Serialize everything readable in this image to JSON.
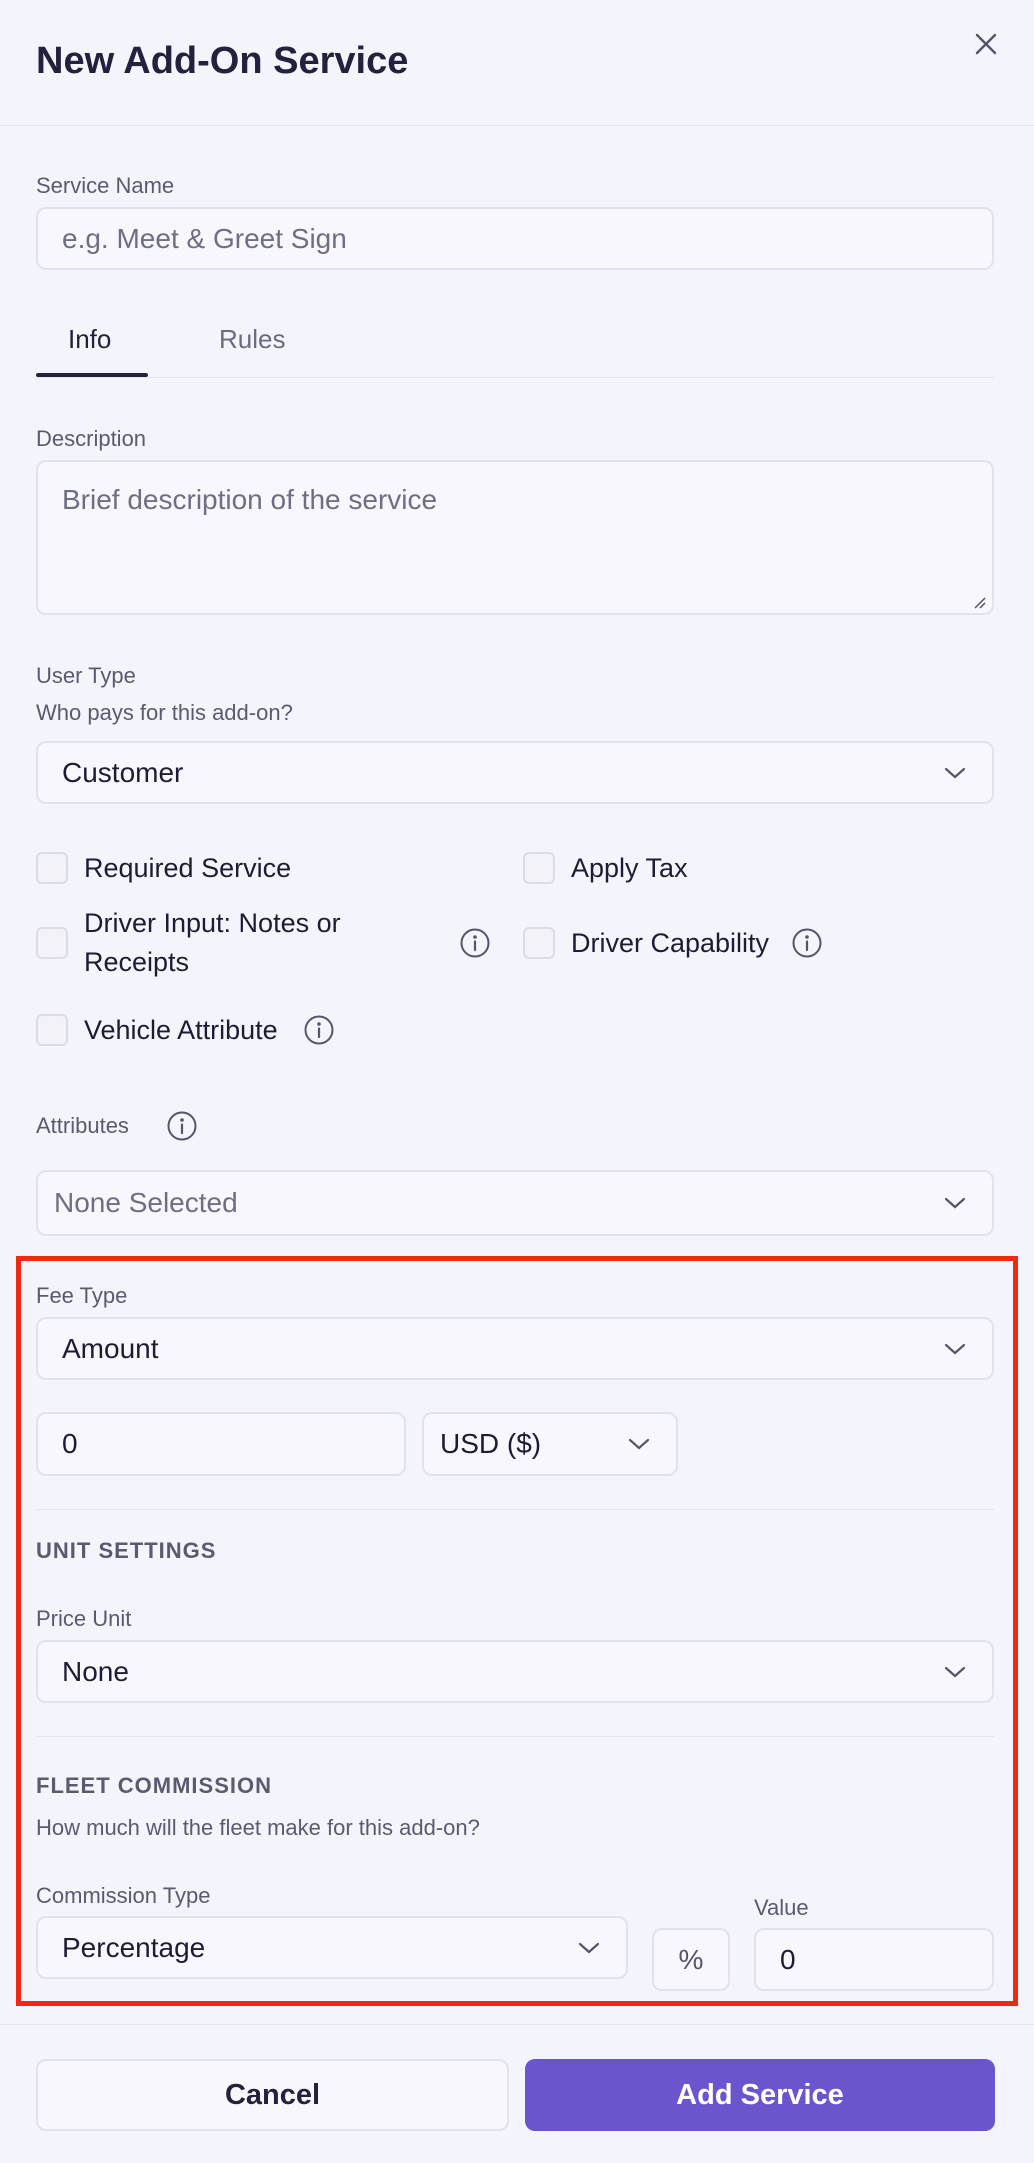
{
  "header": {
    "title": "New Add-On Service",
    "close_icon": "close-icon"
  },
  "service_name": {
    "label": "Service Name",
    "placeholder": "e.g. Meet & Greet Sign",
    "value": ""
  },
  "tabs": [
    {
      "label": "Info",
      "active": true
    },
    {
      "label": "Rules",
      "active": false
    }
  ],
  "description": {
    "label": "Description",
    "placeholder": "Brief description of the service",
    "value": ""
  },
  "user_type": {
    "label": "User Type",
    "hint": "Who pays for this add-on?",
    "selected": "Customer"
  },
  "checkboxes": [
    {
      "label": "Required Service",
      "checked": false,
      "info": false
    },
    {
      "label": "Apply Tax",
      "checked": false,
      "info": false
    },
    {
      "label_line1": "Driver Input: Notes or",
      "label_line2": "Receipts",
      "checked": false,
      "info": true
    },
    {
      "label": "Driver Capability",
      "checked": false,
      "info": true
    },
    {
      "label": "Vehicle Attribute",
      "checked": false,
      "info": true
    }
  ],
  "attributes": {
    "label": "Attributes",
    "selected": "None Selected"
  },
  "fee": {
    "label": "Fee Type",
    "selected": "Amount",
    "amount": "0",
    "currency": "USD ($)"
  },
  "unit_settings": {
    "heading": "UNIT SETTINGS",
    "price_unit_label": "Price Unit",
    "price_unit": "None"
  },
  "fleet_commission": {
    "heading": "FLEET COMMISSION",
    "hint": "How much will the fleet make for this add-on?",
    "commission_type_label": "Commission Type",
    "commission_type": "Percentage",
    "unit_symbol": "%",
    "value_label": "Value",
    "value": "0"
  },
  "footer": {
    "cancel_label": "Cancel",
    "submit_label": "Add Service"
  },
  "colors": {
    "primary": "#6a55cf",
    "highlight": "#f02a12",
    "background": "#f4f4fc"
  }
}
